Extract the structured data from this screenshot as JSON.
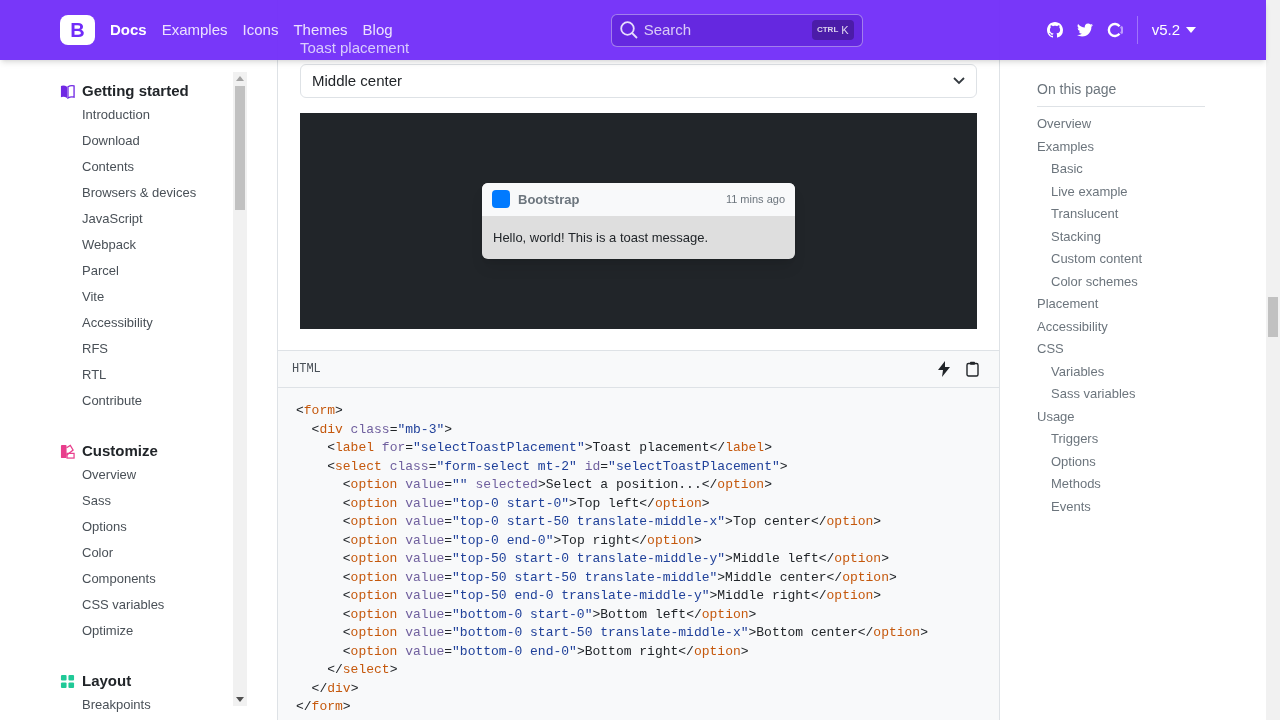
{
  "navbar": {
    "logo": "B",
    "links": [
      {
        "label": "Docs",
        "selected": true
      },
      {
        "label": "Examples",
        "selected": false
      },
      {
        "label": "Icons",
        "selected": false
      },
      {
        "label": "Themes",
        "selected": false
      },
      {
        "label": "Blog",
        "selected": false
      }
    ],
    "search": {
      "placeholder": "Search",
      "shortcut_mod": "CTRL",
      "shortcut_key": "K"
    },
    "version": "v5.2"
  },
  "sidebar": {
    "sections": [
      {
        "title": "Getting started",
        "color": "#7028e4",
        "kind": "book",
        "items": [
          "Introduction",
          "Download",
          "Contents",
          "Browsers & devices",
          "JavaScript",
          "Webpack",
          "Parcel",
          "Vite",
          "Accessibility",
          "RFS",
          "RTL",
          "Contribute"
        ]
      },
      {
        "title": "Customize",
        "color": "#e83e8c",
        "kind": "palette",
        "items": [
          "Overview",
          "Sass",
          "Options",
          "Color",
          "Components",
          "CSS variables",
          "Optimize"
        ]
      },
      {
        "title": "Layout",
        "color": "#20c997",
        "kind": "grid",
        "items": [
          "Breakpoints"
        ]
      }
    ]
  },
  "example": {
    "label": "Toast placement",
    "select_value": "Middle center",
    "toast": {
      "title": "Bootstrap",
      "time": "11 mins ago",
      "body": "Hello, world! This is a toast message."
    }
  },
  "code": {
    "language": "HTML",
    "lines": [
      [
        {
          "kind": "pn",
          "text": "<"
        },
        {
          "kind": "tag",
          "text": "form"
        },
        {
          "kind": "pn",
          "text": ">"
        }
      ],
      [
        {
          "kind": "pn",
          "text": "  <"
        },
        {
          "kind": "tag",
          "text": "div"
        },
        {
          "kind": "attr",
          "text": " class"
        },
        {
          "kind": "pn",
          "text": "="
        },
        {
          "kind": "str",
          "text": "\"mb-3\""
        },
        {
          "kind": "pn",
          "text": ">"
        }
      ],
      [
        {
          "kind": "pn",
          "text": "    <"
        },
        {
          "kind": "tag",
          "text": "label"
        },
        {
          "kind": "attr",
          "text": " for"
        },
        {
          "kind": "pn",
          "text": "="
        },
        {
          "kind": "str",
          "text": "\"selectToastPlacement\""
        },
        {
          "kind": "pn",
          "text": ">"
        },
        {
          "kind": "txt",
          "text": "Toast placement"
        },
        {
          "kind": "pn",
          "text": "</"
        },
        {
          "kind": "tag",
          "text": "label"
        },
        {
          "kind": "pn",
          "text": ">"
        }
      ],
      [
        {
          "kind": "pn",
          "text": "    <"
        },
        {
          "kind": "tag",
          "text": "select"
        },
        {
          "kind": "attr",
          "text": " class"
        },
        {
          "kind": "pn",
          "text": "="
        },
        {
          "kind": "str",
          "text": "\"form-select mt-2\""
        },
        {
          "kind": "attr",
          "text": " id"
        },
        {
          "kind": "pn",
          "text": "="
        },
        {
          "kind": "str",
          "text": "\"selectToastPlacement\""
        },
        {
          "kind": "pn",
          "text": ">"
        }
      ],
      [
        {
          "kind": "pn",
          "text": "      <"
        },
        {
          "kind": "tag",
          "text": "option"
        },
        {
          "kind": "attr",
          "text": " value"
        },
        {
          "kind": "pn",
          "text": "="
        },
        {
          "kind": "str",
          "text": "\"\""
        },
        {
          "kind": "attr",
          "text": " selected"
        },
        {
          "kind": "pn",
          "text": ">"
        },
        {
          "kind": "txt",
          "text": "Select a position..."
        },
        {
          "kind": "pn",
          "text": "</"
        },
        {
          "kind": "tag",
          "text": "option"
        },
        {
          "kind": "pn",
          "text": ">"
        }
      ],
      [
        {
          "kind": "pn",
          "text": "      <"
        },
        {
          "kind": "tag",
          "text": "option"
        },
        {
          "kind": "attr",
          "text": " value"
        },
        {
          "kind": "pn",
          "text": "="
        },
        {
          "kind": "str",
          "text": "\"top-0 start-0\""
        },
        {
          "kind": "pn",
          "text": ">"
        },
        {
          "kind": "txt",
          "text": "Top left"
        },
        {
          "kind": "pn",
          "text": "</"
        },
        {
          "kind": "tag",
          "text": "option"
        },
        {
          "kind": "pn",
          "text": ">"
        }
      ],
      [
        {
          "kind": "pn",
          "text": "      <"
        },
        {
          "kind": "tag",
          "text": "option"
        },
        {
          "kind": "attr",
          "text": " value"
        },
        {
          "kind": "pn",
          "text": "="
        },
        {
          "kind": "str",
          "text": "\"top-0 start-50 translate-middle-x\""
        },
        {
          "kind": "pn",
          "text": ">"
        },
        {
          "kind": "txt",
          "text": "Top center"
        },
        {
          "kind": "pn",
          "text": "</"
        },
        {
          "kind": "tag",
          "text": "option"
        },
        {
          "kind": "pn",
          "text": ">"
        }
      ],
      [
        {
          "kind": "pn",
          "text": "      <"
        },
        {
          "kind": "tag",
          "text": "option"
        },
        {
          "kind": "attr",
          "text": " value"
        },
        {
          "kind": "pn",
          "text": "="
        },
        {
          "kind": "str",
          "text": "\"top-0 end-0\""
        },
        {
          "kind": "pn",
          "text": ">"
        },
        {
          "kind": "txt",
          "text": "Top right"
        },
        {
          "kind": "pn",
          "text": "</"
        },
        {
          "kind": "tag",
          "text": "option"
        },
        {
          "kind": "pn",
          "text": ">"
        }
      ],
      [
        {
          "kind": "pn",
          "text": "      <"
        },
        {
          "kind": "tag",
          "text": "option"
        },
        {
          "kind": "attr",
          "text": " value"
        },
        {
          "kind": "pn",
          "text": "="
        },
        {
          "kind": "str",
          "text": "\"top-50 start-0 translate-middle-y\""
        },
        {
          "kind": "pn",
          "text": ">"
        },
        {
          "kind": "txt",
          "text": "Middle left"
        },
        {
          "kind": "pn",
          "text": "</"
        },
        {
          "kind": "tag",
          "text": "option"
        },
        {
          "kind": "pn",
          "text": ">"
        }
      ],
      [
        {
          "kind": "pn",
          "text": "      <"
        },
        {
          "kind": "tag",
          "text": "option"
        },
        {
          "kind": "attr",
          "text": " value"
        },
        {
          "kind": "pn",
          "text": "="
        },
        {
          "kind": "str",
          "text": "\"top-50 start-50 translate-middle\""
        },
        {
          "kind": "pn",
          "text": ">"
        },
        {
          "kind": "txt",
          "text": "Middle center"
        },
        {
          "kind": "pn",
          "text": "</"
        },
        {
          "kind": "tag",
          "text": "option"
        },
        {
          "kind": "pn",
          "text": ">"
        }
      ],
      [
        {
          "kind": "pn",
          "text": "      <"
        },
        {
          "kind": "tag",
          "text": "option"
        },
        {
          "kind": "attr",
          "text": " value"
        },
        {
          "kind": "pn",
          "text": "="
        },
        {
          "kind": "str",
          "text": "\"top-50 end-0 translate-middle-y\""
        },
        {
          "kind": "pn",
          "text": ">"
        },
        {
          "kind": "txt",
          "text": "Middle right"
        },
        {
          "kind": "pn",
          "text": "</"
        },
        {
          "kind": "tag",
          "text": "option"
        },
        {
          "kind": "pn",
          "text": ">"
        }
      ],
      [
        {
          "kind": "pn",
          "text": "      <"
        },
        {
          "kind": "tag",
          "text": "option"
        },
        {
          "kind": "attr",
          "text": " value"
        },
        {
          "kind": "pn",
          "text": "="
        },
        {
          "kind": "str",
          "text": "\"bottom-0 start-0\""
        },
        {
          "kind": "pn",
          "text": ">"
        },
        {
          "kind": "txt",
          "text": "Bottom left"
        },
        {
          "kind": "pn",
          "text": "</"
        },
        {
          "kind": "tag",
          "text": "option"
        },
        {
          "kind": "pn",
          "text": ">"
        }
      ],
      [
        {
          "kind": "pn",
          "text": "      <"
        },
        {
          "kind": "tag",
          "text": "option"
        },
        {
          "kind": "attr",
          "text": " value"
        },
        {
          "kind": "pn",
          "text": "="
        },
        {
          "kind": "str",
          "text": "\"bottom-0 start-50 translate-middle-x\""
        },
        {
          "kind": "pn",
          "text": ">"
        },
        {
          "kind": "txt",
          "text": "Bottom center"
        },
        {
          "kind": "pn",
          "text": "</"
        },
        {
          "kind": "tag",
          "text": "option"
        },
        {
          "kind": "pn",
          "text": ">"
        }
      ],
      [
        {
          "kind": "pn",
          "text": "      <"
        },
        {
          "kind": "tag",
          "text": "option"
        },
        {
          "kind": "attr",
          "text": " value"
        },
        {
          "kind": "pn",
          "text": "="
        },
        {
          "kind": "str",
          "text": "\"bottom-0 end-0\""
        },
        {
          "kind": "pn",
          "text": ">"
        },
        {
          "kind": "txt",
          "text": "Bottom right"
        },
        {
          "kind": "pn",
          "text": "</"
        },
        {
          "kind": "tag",
          "text": "option"
        },
        {
          "kind": "pn",
          "text": ">"
        }
      ],
      [
        {
          "kind": "pn",
          "text": "    </"
        },
        {
          "kind": "tag",
          "text": "select"
        },
        {
          "kind": "pn",
          "text": ">"
        }
      ],
      [
        {
          "kind": "pn",
          "text": "  </"
        },
        {
          "kind": "tag",
          "text": "div"
        },
        {
          "kind": "pn",
          "text": ">"
        }
      ],
      [
        {
          "kind": "pn",
          "text": "</"
        },
        {
          "kind": "tag",
          "text": "form"
        },
        {
          "kind": "pn",
          "text": ">"
        }
      ]
    ]
  },
  "toc": {
    "title": "On this page",
    "items": [
      {
        "label": "Overview"
      },
      {
        "label": "Examples",
        "children": [
          {
            "label": "Basic"
          },
          {
            "label": "Live example"
          },
          {
            "label": "Translucent"
          },
          {
            "label": "Stacking"
          },
          {
            "label": "Custom content"
          },
          {
            "label": "Color schemes"
          }
        ]
      },
      {
        "label": "Placement"
      },
      {
        "label": "Accessibility"
      },
      {
        "label": "CSS",
        "children": [
          {
            "label": "Variables"
          },
          {
            "label": "Sass variables"
          }
        ]
      },
      {
        "label": "Usage",
        "children": [
          {
            "label": "Triggers"
          },
          {
            "label": "Options"
          },
          {
            "label": "Methods"
          },
          {
            "label": "Events"
          }
        ]
      }
    ]
  }
}
